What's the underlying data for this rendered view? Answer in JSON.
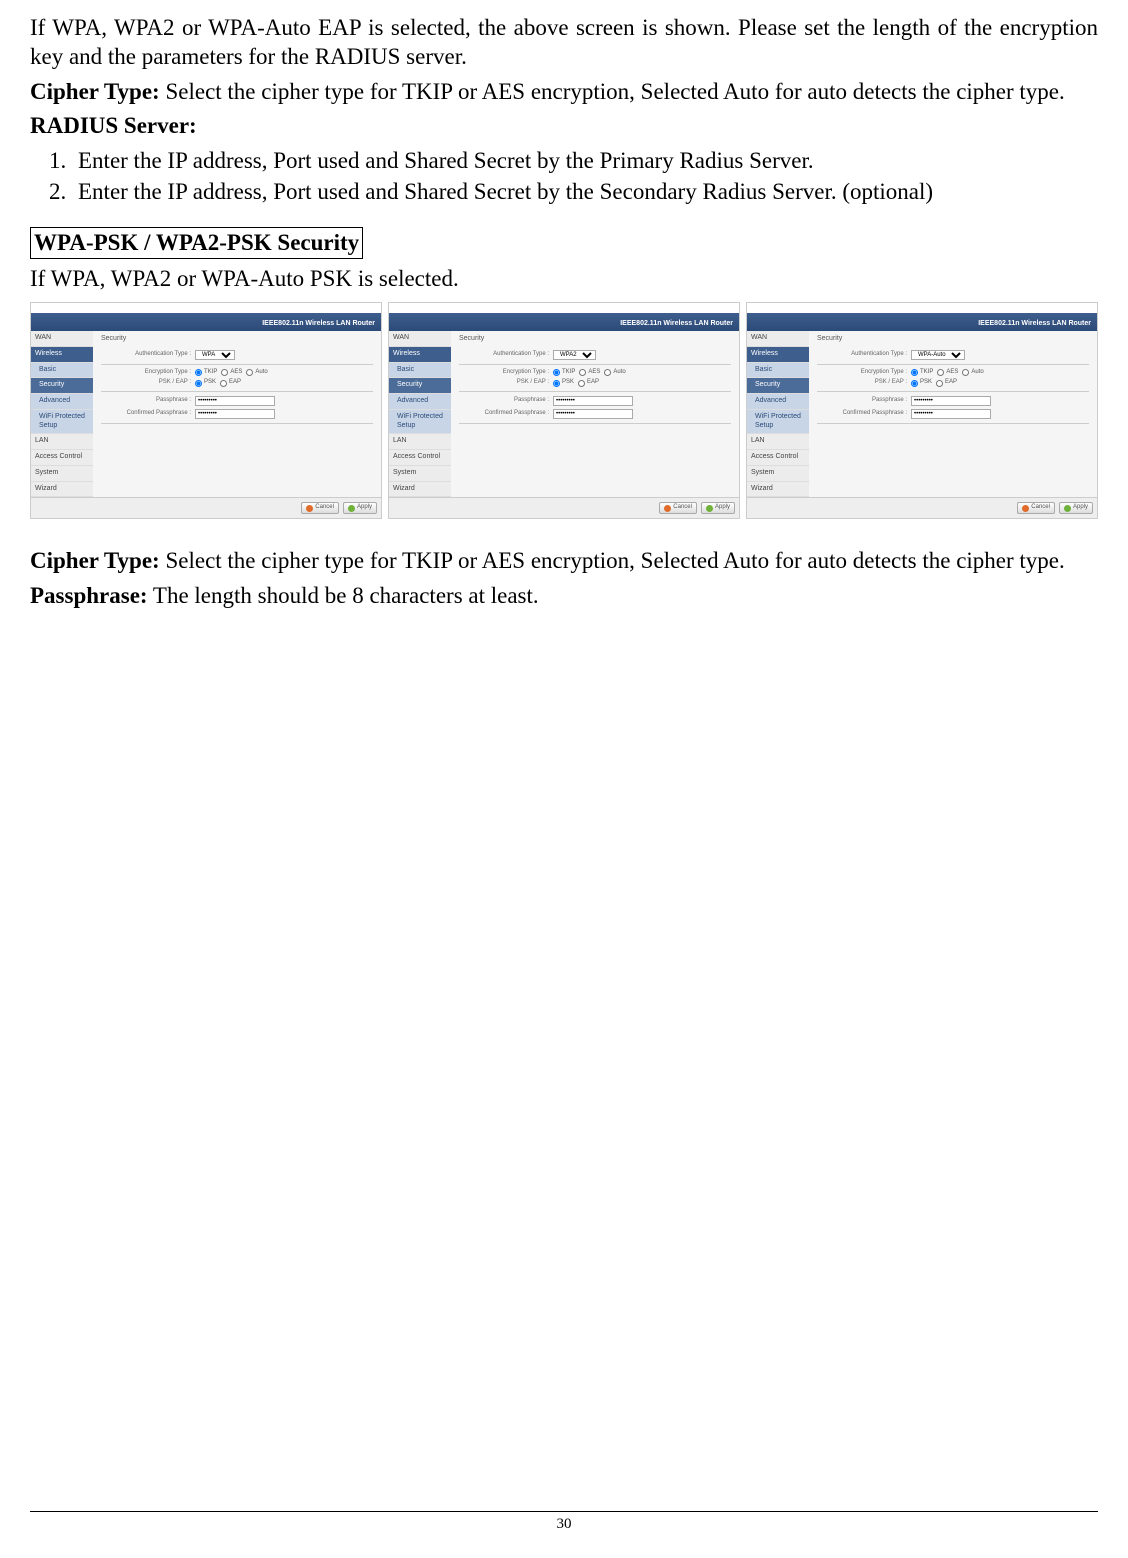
{
  "p_intro_eap": "If WPA, WPA2 or WPA-Auto EAP is selected, the above screen is shown.  Please set the length of the encryption key and the parameters for the RADIUS server.",
  "cipher_label": "Cipher Type:",
  "cipher_text": " Select the cipher type for TKIP or AES encryption, Selected Auto for auto detects the cipher type.",
  "radius_label": "RADIUS Server:",
  "radius_items": {
    "0": "Enter the IP address, Port used and Shared Secret by the Primary Radius Server.",
    "1": "Enter the IP address, Port used and Shared Secret by the Secondary Radius Server. (optional)"
  },
  "section_heading": "WPA-PSK / WPA2-PSK Security",
  "p_psk_intro": "If WPA, WPA2 or WPA-Auto PSK is selected.",
  "passphrase_label": "Passphrase:",
  "passphrase_text": " The length should be 8 characters at least.",
  "page_number": "30",
  "shot": {
    "banner": "IEEE802.11n  Wireless LAN Router",
    "nav": {
      "wan": "WAN",
      "wireless": "Wireless",
      "basic": "Basic",
      "security": "Security",
      "advanced": "Advanced",
      "wps": "WiFi Protected Setup",
      "lan": "LAN",
      "access": "Access Control",
      "system": "System",
      "wizard": "Wizard"
    },
    "panel_title": "Security",
    "labels": {
      "auth": "Authentication Type :",
      "enc": "Encryption Type :",
      "pskeap": "PSK / EAP :",
      "pass": "Passphrase :",
      "cpass": "Confirmed Passphrase :"
    },
    "enc_opts": {
      "tkip": "TKIP",
      "aes": "AES",
      "auto": "Auto"
    },
    "pskeap_opts": {
      "psk": "PSK",
      "eap": "EAP"
    },
    "auth_values": {
      "0": "WPA",
      "1": "WPA2",
      "2": "WPA-Auto"
    },
    "btn_cancel": "Cancel",
    "btn_apply": "Apply"
  }
}
